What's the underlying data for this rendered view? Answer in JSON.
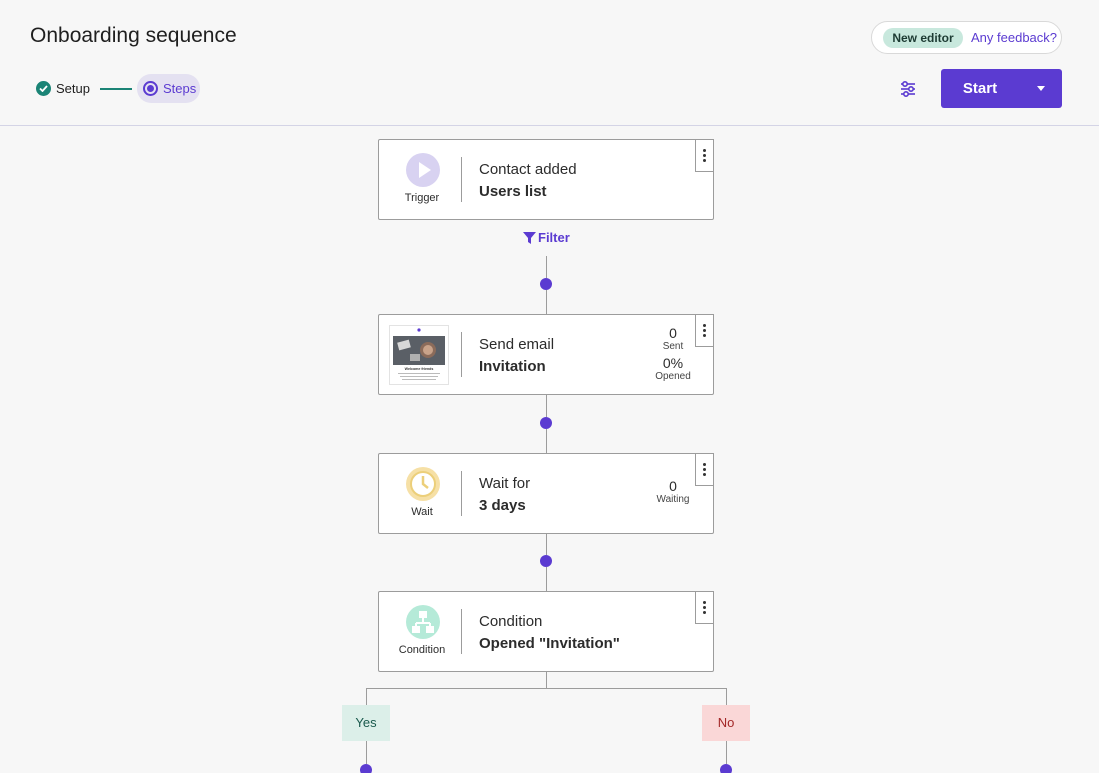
{
  "header": {
    "title": "Onboarding sequence",
    "new_editor_badge": "New editor",
    "feedback_link": "Any feedback?",
    "start_button": "Start"
  },
  "stepper": {
    "setup_label": "Setup",
    "steps_label": "Steps"
  },
  "flow": {
    "trigger": {
      "type_label": "Trigger",
      "title": "Contact added",
      "subtitle": "Users list"
    },
    "filter_label": "Filter",
    "email": {
      "title": "Send email",
      "subtitle": "Invitation",
      "sent_value": "0",
      "sent_label": "Sent",
      "opened_value": "0%",
      "opened_label": "Opened",
      "thumbnail_heading": "Welcome friends"
    },
    "wait": {
      "type_label": "Wait",
      "title": "Wait for",
      "subtitle": "3 days",
      "waiting_value": "0",
      "waiting_label": "Waiting"
    },
    "condition": {
      "type_label": "Condition",
      "title": "Condition",
      "subtitle": "Opened \"Invitation\""
    },
    "branch_yes": "Yes",
    "branch_no": "No"
  },
  "colors": {
    "accent": "#5b3bd1",
    "success": "#1b8476",
    "yes_bg": "#dcefe9",
    "no_bg": "#fad7d7"
  },
  "icons": {
    "trigger": "play-icon",
    "wait": "clock-icon",
    "condition": "branch-icon",
    "settings": "sliders-icon",
    "filter": "funnel-icon"
  }
}
